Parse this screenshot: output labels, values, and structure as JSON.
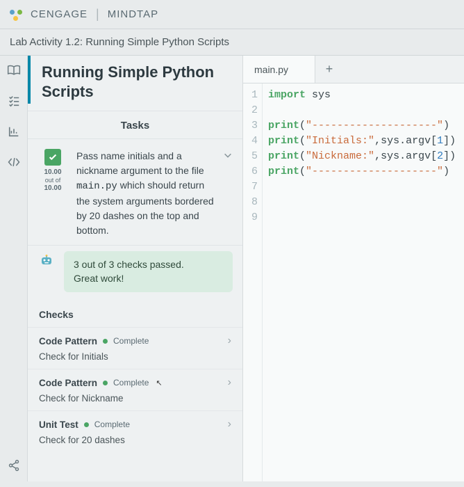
{
  "header": {
    "brand": "CENGAGE",
    "product": "MINDTAP"
  },
  "subheader": "Lab Activity 1.2: Running Simple Python Scripts",
  "rail": {
    "book": "book-icon",
    "list": "list-icon",
    "chart": "chart-icon",
    "code": "code-icon",
    "share": "share-icon"
  },
  "panel": {
    "title": "Running Simple Python Scripts",
    "tasks_heading": "Tasks",
    "task": {
      "score_top": "10.00",
      "score_outof": "out of",
      "score_bot": "10.00",
      "body_pre": "Pass name initials and a nickname argument to the file ",
      "body_code": "main.py",
      "body_post": " which should return the system arguments bordered by 20 dashes on the top and bottom."
    },
    "result_line1": "3 out of 3 checks passed.",
    "result_line2": "Great work!",
    "checks_heading": "Checks",
    "checks": [
      {
        "type": "Code Pattern",
        "status": "Complete",
        "desc": "Check for Initials",
        "cursor": false
      },
      {
        "type": "Code Pattern",
        "status": "Complete",
        "desc": "Check for Nickname",
        "cursor": true
      },
      {
        "type": "Unit Test",
        "status": "Complete",
        "desc": "Check for 20 dashes",
        "cursor": false
      }
    ]
  },
  "editor": {
    "tab": "main.py",
    "lines": [
      {
        "n": 1,
        "tokens": [
          {
            "t": "import",
            "c": "kw"
          },
          {
            "t": " ",
            "c": ""
          },
          {
            "t": "sys",
            "c": "id"
          }
        ]
      },
      {
        "n": 2,
        "tokens": []
      },
      {
        "n": 3,
        "tokens": [
          {
            "t": "print",
            "c": "fn"
          },
          {
            "t": "(",
            "c": ""
          },
          {
            "t": "\"--------------------\"",
            "c": "str"
          },
          {
            "t": ")",
            "c": ""
          }
        ]
      },
      {
        "n": 4,
        "tokens": [
          {
            "t": "print",
            "c": "fn"
          },
          {
            "t": "(",
            "c": ""
          },
          {
            "t": "\"Initials:\"",
            "c": "str"
          },
          {
            "t": ",",
            "c": ""
          },
          {
            "t": "sys",
            "c": "id"
          },
          {
            "t": ".",
            "c": ""
          },
          {
            "t": "argv",
            "c": "id"
          },
          {
            "t": "[",
            "c": ""
          },
          {
            "t": "1",
            "c": "num"
          },
          {
            "t": "])",
            "c": ""
          }
        ]
      },
      {
        "n": 5,
        "tokens": [
          {
            "t": "print",
            "c": "fn"
          },
          {
            "t": "(",
            "c": ""
          },
          {
            "t": "\"Nickname:\"",
            "c": "str"
          },
          {
            "t": ",",
            "c": ""
          },
          {
            "t": "sys",
            "c": "id"
          },
          {
            "t": ".",
            "c": ""
          },
          {
            "t": "argv",
            "c": "id"
          },
          {
            "t": "[",
            "c": ""
          },
          {
            "t": "2",
            "c": "num"
          },
          {
            "t": "])",
            "c": ""
          }
        ]
      },
      {
        "n": 6,
        "tokens": [
          {
            "t": "print",
            "c": "fn"
          },
          {
            "t": "(",
            "c": ""
          },
          {
            "t": "\"--------------------\"",
            "c": "str"
          },
          {
            "t": ")",
            "c": ""
          }
        ]
      },
      {
        "n": 7,
        "tokens": []
      },
      {
        "n": 8,
        "tokens": []
      },
      {
        "n": 9,
        "tokens": []
      }
    ]
  }
}
